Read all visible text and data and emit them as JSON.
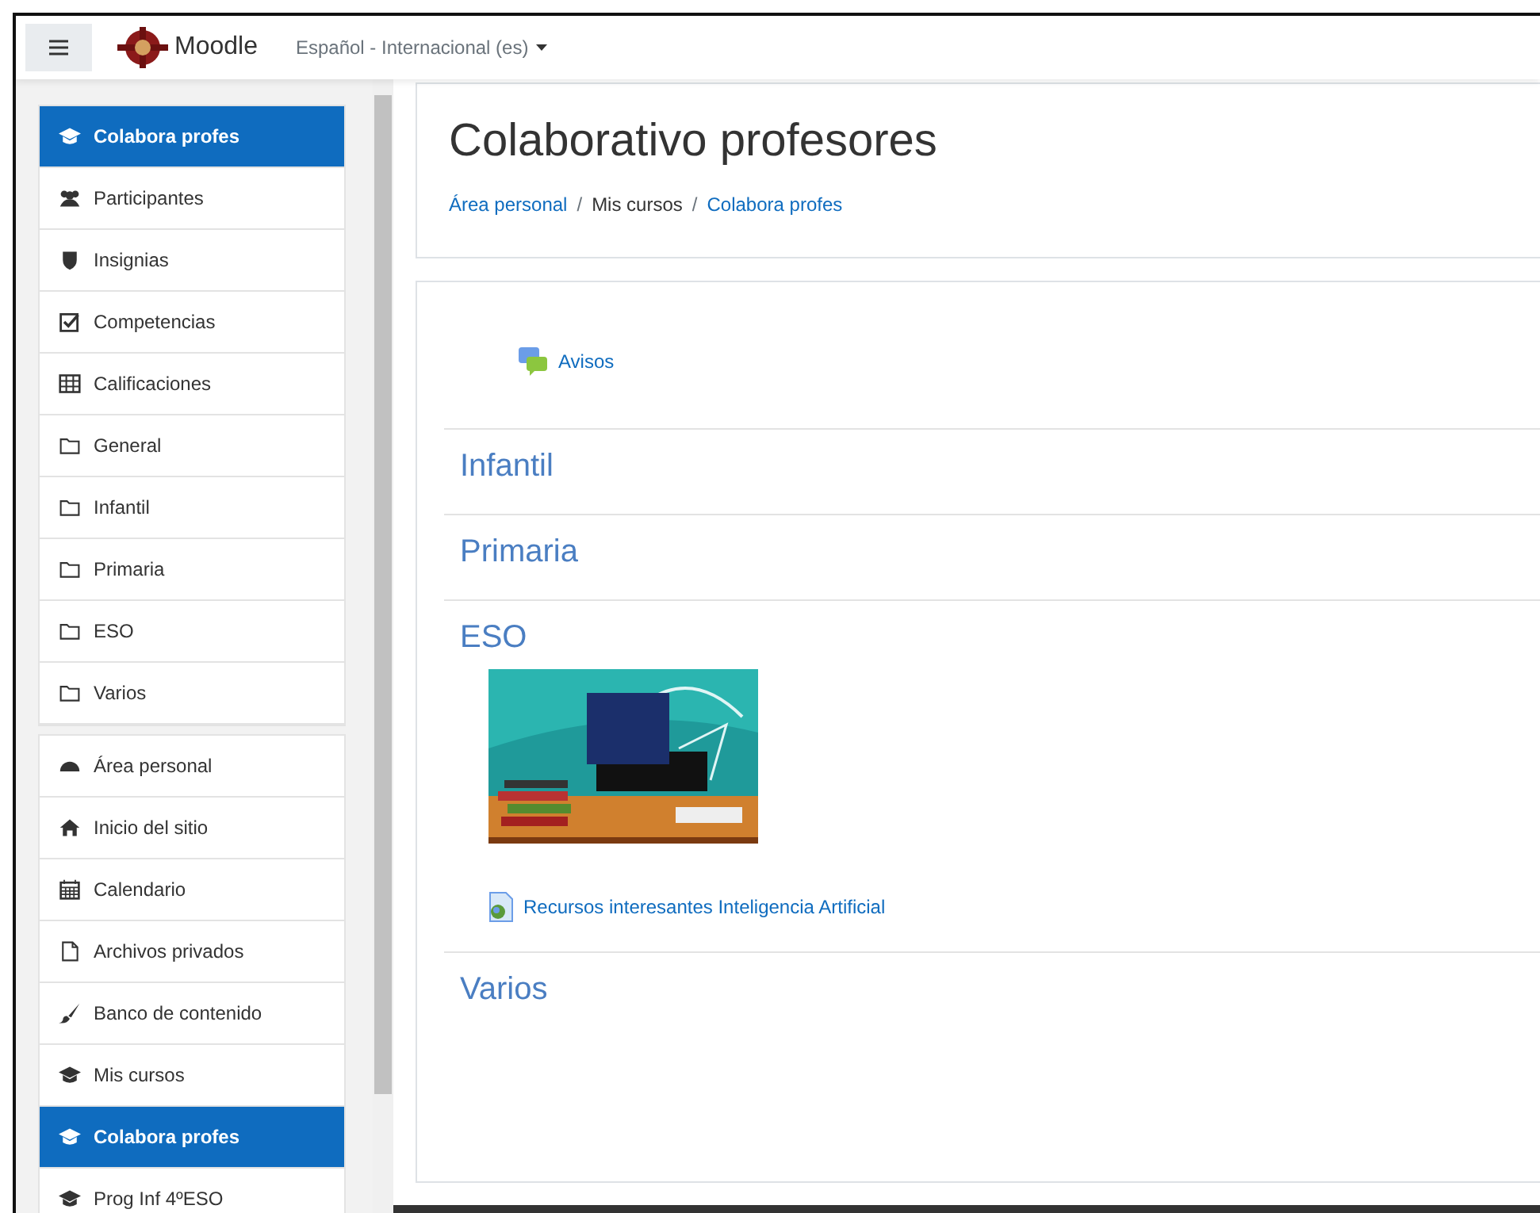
{
  "navbar": {
    "brand": "Moodle",
    "language": "Español - Internacional (es)"
  },
  "sidebar": {
    "groups": [
      {
        "items": [
          {
            "label": "Colabora profes",
            "selected": true
          },
          {
            "label": "Participantes",
            "selected": false
          },
          {
            "label": "Insignias",
            "selected": false
          },
          {
            "label": "Competencias",
            "selected": false
          },
          {
            "label": "Calificaciones",
            "selected": false
          },
          {
            "label": "General",
            "selected": false
          },
          {
            "label": "Infantil",
            "selected": false
          },
          {
            "label": "Primaria",
            "selected": false
          },
          {
            "label": "ESO",
            "selected": false
          },
          {
            "label": "Varios",
            "selected": false
          }
        ]
      },
      {
        "items": [
          {
            "label": "Área personal",
            "selected": false
          },
          {
            "label": "Inicio del sitio",
            "selected": false
          },
          {
            "label": "Calendario",
            "selected": false
          },
          {
            "label": "Archivos privados",
            "selected": false
          },
          {
            "label": "Banco de contenido",
            "selected": false
          },
          {
            "label": "Mis cursos",
            "selected": false
          },
          {
            "label": "Colabora profes",
            "selected": true
          },
          {
            "label": "Prog Inf 4ºESO",
            "selected": false
          }
        ]
      }
    ]
  },
  "header": {
    "title": "Colaborativo profesores",
    "breadcrumb_separator": "/",
    "breadcrumb": [
      {
        "label": "Área personal",
        "link": true
      },
      {
        "label": "Mis cursos",
        "link": false
      },
      {
        "label": "Colabora profes",
        "link": true
      }
    ]
  },
  "sections": [
    {
      "activities": [
        {
          "kind": "forum",
          "label": "Avisos"
        }
      ]
    },
    {
      "title": "Infantil"
    },
    {
      "title": "Primaria"
    },
    {
      "title": "ESO",
      "activities": [
        {
          "kind": "picture"
        },
        {
          "kind": "url",
          "label": "Recursos interesantes Inteligencia Artificial"
        }
      ]
    },
    {
      "title": "Varios"
    }
  ]
}
